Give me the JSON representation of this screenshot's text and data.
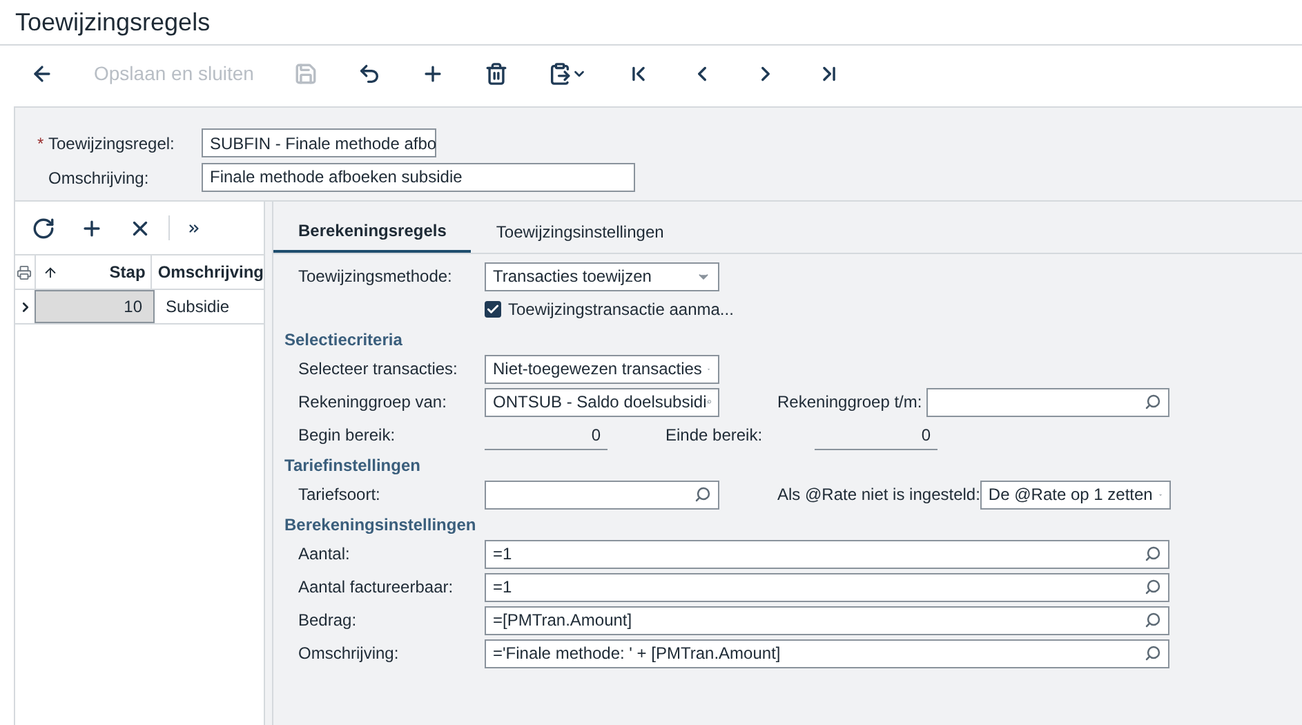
{
  "title": "Toewijzingsregels",
  "toolbar": [
    {
      "kind": "back",
      "disabled": false
    },
    {
      "kind": "text",
      "label": "Opslaan en sluiten",
      "disabled": true
    },
    {
      "kind": "save",
      "disabled": true
    },
    {
      "kind": "undo",
      "disabled": false
    },
    {
      "kind": "add",
      "disabled": false
    },
    {
      "kind": "delete",
      "disabled": false
    },
    {
      "kind": "paste",
      "disabled": false
    },
    {
      "kind": "first",
      "disabled": false
    },
    {
      "kind": "prev",
      "disabled": false
    },
    {
      "kind": "next",
      "disabled": false
    },
    {
      "kind": "last",
      "disabled": false
    }
  ],
  "header": [
    {
      "marker": "*",
      "label": "Toewijzingsregel:",
      "kind": "lookup",
      "value": "SUBFIN - Finale methode afbo"
    },
    {
      "label": "Omschrijving:",
      "kind": "text",
      "value": "Finale methode afboeken subsidie"
    }
  ],
  "grid": {
    "toolbar": [
      {
        "kind": "refresh"
      },
      {
        "kind": "add"
      },
      {
        "kind": "remove"
      },
      {
        "kind": "more"
      }
    ],
    "columns": [
      {
        "label": "Stap"
      },
      {
        "label": "Omschrijving"
      }
    ],
    "rows": [
      {
        "stap": "10",
        "omschrijving": "Subsidie",
        "selected": true
      }
    ]
  },
  "tabs": [
    {
      "label": "Berekeningsregels",
      "selected": true
    },
    {
      "label": "Toewijzingsinstellingen",
      "selected": false
    }
  ],
  "form": [
    {
      "kind": "row",
      "items": [
        {
          "label": "Toewijzingsmethode:",
          "kind": "select",
          "value": "Transacties toewijzen"
        }
      ]
    },
    {
      "kind": "row",
      "items": [
        {
          "kind": "checkbox",
          "value": "Toewijzingstransactie aanma...",
          "checked": true
        }
      ]
    },
    {
      "kind": "heading",
      "text": "Selectiecriteria"
    },
    {
      "kind": "row",
      "items": [
        {
          "label": "Selecteer transacties:",
          "kind": "select",
          "value": "Niet-toegewezen transacties"
        }
      ]
    },
    {
      "kind": "row",
      "items": [
        {
          "label": "Rekeninggroep van:",
          "kind": "lookup",
          "value": "ONTSUB - Saldo doelsubsidi"
        },
        {
          "label": "Rekeninggroep t/m:",
          "kind": "lookup"
        }
      ]
    },
    {
      "kind": "row",
      "items": [
        {
          "label": "Begin bereik:",
          "kind": "number",
          "value": "0"
        },
        {
          "label": "Einde bereik:",
          "kind": "number",
          "value": "0"
        }
      ]
    },
    {
      "kind": "heading",
      "text": "Tariefinstellingen"
    },
    {
      "kind": "row",
      "items": [
        {
          "label": "Tariefsoort:",
          "kind": "lookup"
        },
        {
          "label": "Als @Rate niet is ingesteld:",
          "kind": "select",
          "value": "De @Rate op 1 zetten"
        }
      ]
    },
    {
      "kind": "heading",
      "text": "Berekeningsinstellingen"
    },
    {
      "kind": "row",
      "items": [
        {
          "label": "Aantal:",
          "kind": "wide",
          "value": "=1"
        }
      ]
    },
    {
      "kind": "row",
      "items": [
        {
          "label": "Aantal factureerbaar:",
          "kind": "wide",
          "value": "=1"
        }
      ]
    },
    {
      "kind": "row",
      "items": [
        {
          "label": "Bedrag:",
          "kind": "wide",
          "value": "=[PMTran.Amount]"
        }
      ]
    },
    {
      "kind": "row",
      "items": [
        {
          "label": "Omschrijving:",
          "kind": "wide",
          "value": "='Finale methode: ' + [PMTran.Amount]"
        }
      ]
    }
  ]
}
